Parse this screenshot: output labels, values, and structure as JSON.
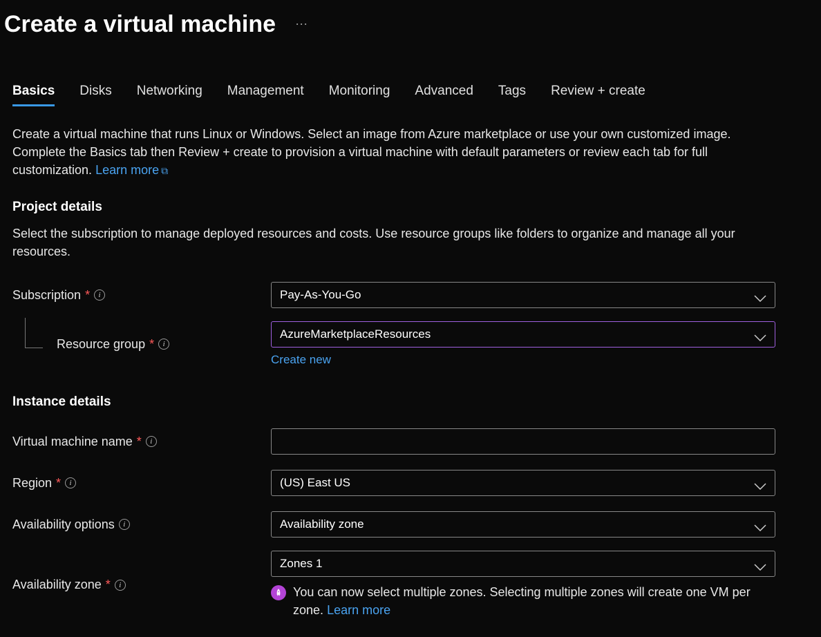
{
  "header": {
    "title": "Create a virtual machine"
  },
  "tabs": [
    {
      "label": "Basics",
      "active": true
    },
    {
      "label": "Disks",
      "active": false
    },
    {
      "label": "Networking",
      "active": false
    },
    {
      "label": "Management",
      "active": false
    },
    {
      "label": "Monitoring",
      "active": false
    },
    {
      "label": "Advanced",
      "active": false
    },
    {
      "label": "Tags",
      "active": false
    },
    {
      "label": "Review + create",
      "active": false
    }
  ],
  "intro": {
    "text": "Create a virtual machine that runs Linux or Windows. Select an image from Azure marketplace or use your own customized image. Complete the Basics tab then Review + create to provision a virtual machine with default parameters or review each tab for full customization.",
    "learn_more": "Learn more"
  },
  "project_details": {
    "heading": "Project details",
    "desc": "Select the subscription to manage deployed resources and costs. Use resource groups like folders to organize and manage all your resources.",
    "subscription": {
      "label": "Subscription",
      "required": true,
      "value": "Pay-As-You-Go"
    },
    "resource_group": {
      "label": "Resource group",
      "required": true,
      "value": "AzureMarketplaceResources",
      "create_new": "Create new"
    }
  },
  "instance_details": {
    "heading": "Instance details",
    "vm_name": {
      "label": "Virtual machine name",
      "required": true,
      "value": ""
    },
    "region": {
      "label": "Region",
      "required": true,
      "value": "(US) East US"
    },
    "availability_options": {
      "label": "Availability options",
      "required": false,
      "value": "Availability zone"
    },
    "availability_zone": {
      "label": "Availability zone",
      "required": true,
      "value": "Zones 1",
      "note": "You can now select multiple zones. Selecting multiple zones will create one VM per zone.",
      "learn_more": "Learn more"
    }
  }
}
